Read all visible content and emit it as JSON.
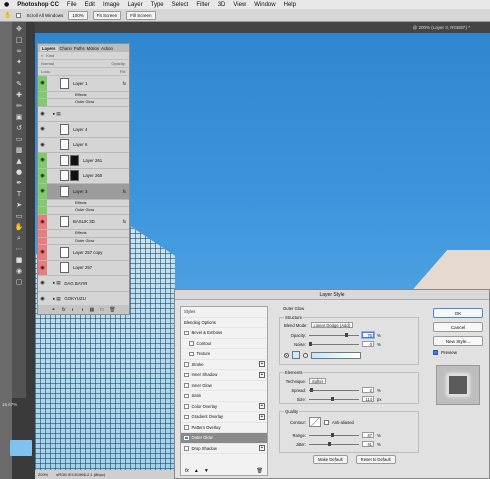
{
  "menubar": {
    "apple": "",
    "app": "Photoshop CC",
    "items": [
      "File",
      "Edit",
      "Image",
      "Layer",
      "Type",
      "Select",
      "Filter",
      "3D",
      "View",
      "Window",
      "Help"
    ]
  },
  "optionsbar": {
    "scroll_all": "Scroll All Windows",
    "zoom": "100%",
    "fit_screen": "Fit Screen",
    "fill_screen": "Fill Screen"
  },
  "document": {
    "tab_title": "@ 200% (Layer 3, RGB/8*) *",
    "zoom_readout": "16.67%"
  },
  "statusbar": {
    "zoom": "200%",
    "doc_info": "sRGB IEC61966-2.1 (8bpc)"
  },
  "layers_panel": {
    "tabs": [
      "Layers",
      "Chann",
      "Paths",
      "Motion",
      "Action"
    ],
    "kind": "Kind",
    "normal": "Normal",
    "opacity_label": "Opacity:",
    "lock_label": "Lock:",
    "fill_label": "Fill:",
    "rows": [
      {
        "name": "Layer 1",
        "color": "green",
        "fx": "fx"
      },
      {
        "name": "Effects",
        "sub": true,
        "color": "green"
      },
      {
        "name": "Outer Glow",
        "sub": true,
        "color": "green"
      },
      {
        "name": "",
        "color": "none",
        "group": true
      },
      {
        "name": "Layer 4",
        "color": "none"
      },
      {
        "name": "Layer 6",
        "color": "none"
      },
      {
        "name": "Layer 261",
        "color": "green"
      },
      {
        "name": "Layer 260",
        "color": "green"
      },
      {
        "name": "Layer 3",
        "color": "green",
        "fx": "fx",
        "selected": true
      },
      {
        "name": "Effects",
        "sub": true,
        "color": "green"
      },
      {
        "name": "Outer Glow",
        "sub": true,
        "color": "green"
      },
      {
        "name": "BASLIK 3D",
        "color": "red",
        "fx": "fx"
      },
      {
        "name": "Effects",
        "sub": true,
        "color": "red"
      },
      {
        "name": "Outer Glow",
        "sub": true,
        "color": "red"
      },
      {
        "name": "Layer 257 copy",
        "color": "red"
      },
      {
        "name": "Layer 257",
        "color": "red"
      },
      {
        "name": "DAG BAYIR",
        "color": "none",
        "group": true
      },
      {
        "name": "GOKYUZU",
        "color": "none",
        "group": true
      }
    ]
  },
  "layer_style": {
    "title": "Layer Style",
    "styles_header": "Styles",
    "blending_options": "Blending Options",
    "styles": [
      {
        "label": "Bevel & Emboss",
        "checked": false,
        "plus": false
      },
      {
        "label": "Contour",
        "checked": false,
        "plus": false,
        "indent": true
      },
      {
        "label": "Texture",
        "checked": false,
        "plus": false,
        "indent": true
      },
      {
        "label": "Stroke",
        "checked": false,
        "plus": true
      },
      {
        "label": "Inner Shadow",
        "checked": false,
        "plus": true
      },
      {
        "label": "Inner Glow",
        "checked": false,
        "plus": false
      },
      {
        "label": "Satin",
        "checked": false,
        "plus": false
      },
      {
        "label": "Color Overlay",
        "checked": false,
        "plus": true
      },
      {
        "label": "Gradient Overlay",
        "checked": false,
        "plus": true
      },
      {
        "label": "Pattern Overlay",
        "checked": false,
        "plus": false
      },
      {
        "label": "Outer Glow",
        "checked": true,
        "plus": false,
        "selected": true
      },
      {
        "label": "Drop Shadow",
        "checked": false,
        "plus": true
      }
    ],
    "section_title": "Outer Glow",
    "structure": {
      "title": "Structure",
      "blend_mode_label": "Blend Mode:",
      "blend_mode": "Linear Dodge (Add)",
      "opacity_label": "Opacity:",
      "opacity": "76",
      "opacity_frac": 0.76,
      "noise_label": "Noise:",
      "noise": "0",
      "noise_frac": 0.0,
      "pct": "%"
    },
    "elements": {
      "title": "Elements",
      "technique_label": "Technique:",
      "technique": "Softer",
      "spread_label": "Spread:",
      "spread": "2",
      "spread_frac": 0.02,
      "size_label": "Size:",
      "size": "114",
      "size_frac": 0.46,
      "size_unit": "px"
    },
    "quality": {
      "title": "Quality",
      "contour_label": "Contour:",
      "anti_aliased": "Anti-aliased",
      "range_label": "Range:",
      "range": "47",
      "range_frac": 0.47,
      "jitter_label": "Jitter:",
      "jitter": "41",
      "jitter_frac": 0.41
    },
    "make_default": "Make Default",
    "reset_default": "Reset to Default",
    "ok": "OK",
    "cancel": "Cancel",
    "new_style": "New Style...",
    "preview": "Preview",
    "fx": "fx"
  },
  "colors": {
    "sky": "#3d96dd",
    "glow": "#c8ecfb",
    "label_green": "#7ecb6a",
    "label_red": "#ec7b7b"
  }
}
